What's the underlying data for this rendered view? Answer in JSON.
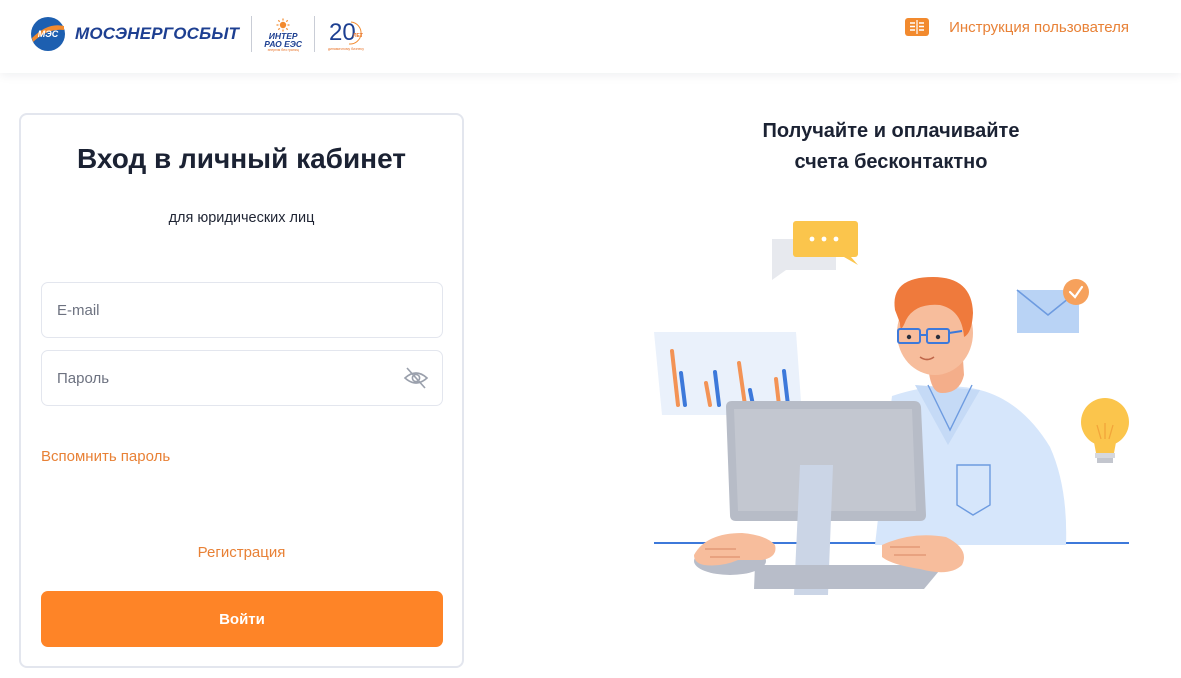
{
  "header": {
    "brand": "МОСЭНЕРГОСБЫТ",
    "brand_mark": "МЭС",
    "partner_name_line1": "ИНТЕР",
    "partner_name_line2": "РАО ЕЭС",
    "partner_sub": "энергия без границ",
    "anniversary_number": "20",
    "anniversary_label": "ЛЕТ",
    "anniversary_sub": "динамичному бизнесу",
    "guide_label": "Инструкция пользователя",
    "guide_icon": "book-icon"
  },
  "login": {
    "title": "Вход в личный кабинет",
    "subtitle": "для юридических лиц",
    "email_placeholder": "E-mail",
    "email_value": "",
    "password_placeholder": "Пароль",
    "password_value": "",
    "password_icon": "eye-off-icon",
    "forgot_label": "Вспомнить пароль",
    "register_label": "Регистрация",
    "submit_label": "Войти"
  },
  "promo": {
    "title_line1": "Получайте и оплачивайте",
    "title_line2": "счета бесконтактно"
  },
  "colors": {
    "accent": "#fe8427",
    "link": "#e88136",
    "brand_blue": "#1d3f91",
    "text": "#1b2233",
    "border": "#e3e6ee"
  }
}
